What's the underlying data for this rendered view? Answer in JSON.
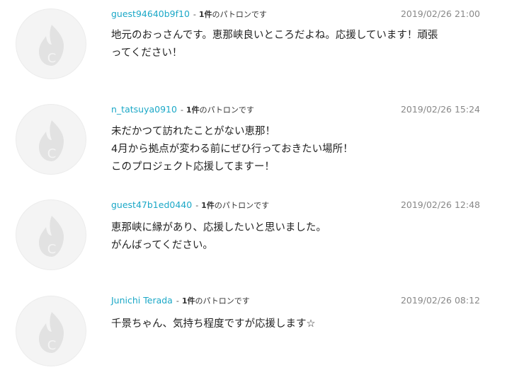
{
  "comments": [
    {
      "username": "guest94640b9f10",
      "separator": "-",
      "patron_count": "1件",
      "patron_suffix": "のパトロンです",
      "date": "2019/02/26 21:00",
      "lines": [
        "地元のおっさんです。恵那峡良いところだよね。応援しています！頑張",
        "ってください！"
      ]
    },
    {
      "username": "n_tatsuya0910",
      "separator": "-",
      "patron_count": "1件",
      "patron_suffix": "のパトロンです",
      "date": "2019/02/26 15:24",
      "lines": [
        "未だかつて訪れたことがない恵那！",
        "4月から拠点が変わる前にぜひ行っておきたい場所！",
        "このプロジェクト応援してますー！"
      ]
    },
    {
      "username": "guest47b1ed0440",
      "separator": "-",
      "patron_count": "1件",
      "patron_suffix": "のパトロンです",
      "date": "2019/02/26 12:48",
      "lines": [
        "恵那峡に縁があり、応援したいと思いました。",
        "がんばってください。"
      ]
    },
    {
      "username": "Junichi Terada",
      "separator": "-",
      "patron_count": "1件",
      "patron_suffix": "のパトロンです",
      "date": "2019/02/26 08:12",
      "lines": [
        "千景ちゃん、気持ち程度ですが応援します☆"
      ]
    }
  ],
  "avatar_icon": "flame-c-icon",
  "colors": {
    "username": "#1ba8c7",
    "date": "#888888",
    "avatar_bg": "#f4f4f4",
    "avatar_mark": "#e2e2e2"
  }
}
